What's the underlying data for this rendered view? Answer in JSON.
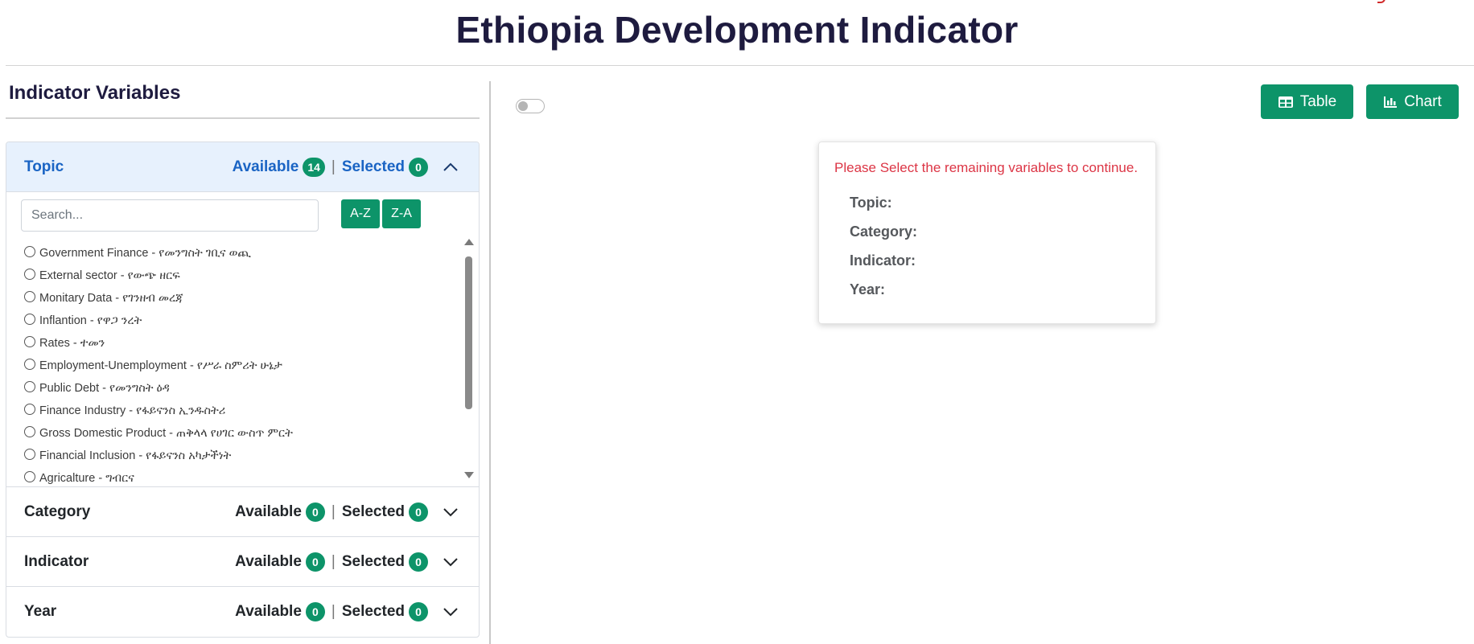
{
  "page": {
    "title": "Ethiopia Development Indicator"
  },
  "colors": {
    "accent": "#0d9469",
    "open_header_bg": "#e7f1fd",
    "open_header_text": "#1a64c4",
    "error_text": "#dc3545",
    "title_text": "#1e1b3f"
  },
  "sidebar": {
    "heading": "Indicator Variables",
    "sections": [
      {
        "title": "Topic",
        "expanded": true,
        "available_label": "Available",
        "available_count": "14",
        "separator": "|",
        "selected_label": "Selected",
        "selected_count": "0",
        "chevron_icon": "chevron-up-icon"
      },
      {
        "title": "Category",
        "expanded": false,
        "available_label": "Available",
        "available_count": "0",
        "separator": "|",
        "selected_label": "Selected",
        "selected_count": "0",
        "chevron_icon": "chevron-down-icon"
      },
      {
        "title": "Indicator",
        "expanded": false,
        "available_label": "Available",
        "available_count": "0",
        "separator": "|",
        "selected_label": "Selected",
        "selected_count": "0",
        "chevron_icon": "chevron-down-icon"
      },
      {
        "title": "Year",
        "expanded": false,
        "available_label": "Available",
        "available_count": "0",
        "separator": "|",
        "selected_label": "Selected",
        "selected_count": "0",
        "chevron_icon": "chevron-down-icon"
      }
    ],
    "topic_panel": {
      "search_placeholder": "Search...",
      "search_value": "",
      "sort_az_label": "A-Z",
      "sort_za_label": "Z-A",
      "options": [
        "Government Finance - የመንግስት ገቢና ወጪ",
        "External sector - የውጭ ዘርፍ",
        "Monitary Data - የገንዘብ መረጃ",
        "Inflantion - የዋጋ ንረት",
        "Rates - ተመን",
        "Employment-Unemployment - የሥራ ስምሪት ሁኔታ",
        "Public Debt - የመንግስት ዕዳ",
        "Finance Industry - የፋይናንስ ኢንዱስትሪ",
        "Gross Domestic Product - ጠቅላላ የሀገር ውስጥ ምርት",
        "Financial Inclusion - የፋይናንስ አካታችነት",
        "Agricalture - ግብርና"
      ]
    }
  },
  "toolbar": {
    "toggle_state": "off",
    "table_label": "Table",
    "table_icon": "table-icon",
    "chart_label": "Chart",
    "chart_icon": "bar-chart-icon"
  },
  "message_card": {
    "message": "Please Select the remaining variables to continue.",
    "requirements": [
      "Topic:",
      "Category:",
      "Indicator:",
      "Year:"
    ]
  }
}
